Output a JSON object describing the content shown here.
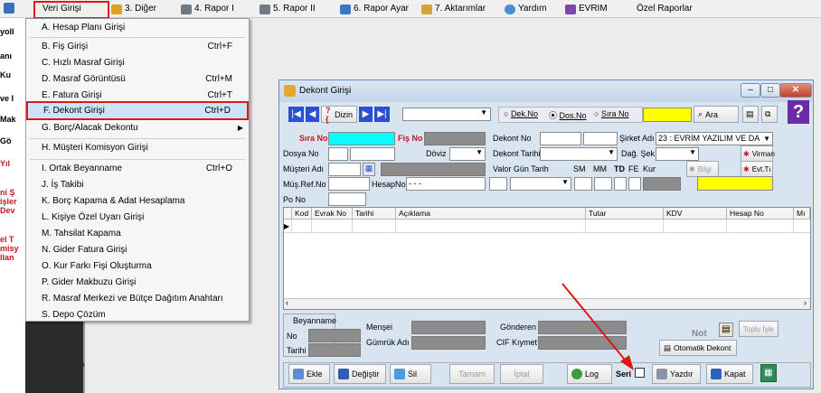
{
  "menubar": {
    "items": [
      {
        "label": "Veri Girişi"
      },
      {
        "label": "3. Diğer"
      },
      {
        "label": "4. Rapor I"
      },
      {
        "label": "5. Rapor II"
      },
      {
        "label": "6. Rapor Ayar"
      },
      {
        "label": "7. Aktarımlar"
      },
      {
        "label": "Yardım"
      },
      {
        "label": "EVRIM"
      },
      {
        "label": "Özel Raporlar"
      }
    ]
  },
  "left_strip": {
    "texts": [
      "yoll",
      "anı",
      "Ku",
      "ve I",
      "Mak",
      "Gö",
      "Yıl",
      "ni Ş",
      "işler",
      "Dev",
      "el T",
      "misy",
      "llan"
    ]
  },
  "dropdown": {
    "items": [
      {
        "label": "A. Hesap Planı Girişi",
        "shortcut": ""
      },
      {
        "label": "B. Fiş Girişi",
        "shortcut": "Ctrl+F"
      },
      {
        "label": "C. Hızlı Masraf Girişi",
        "shortcut": ""
      },
      {
        "label": "D. Masraf Görüntüsü",
        "shortcut": "Ctrl+M"
      },
      {
        "label": "E. Fatura Girişi",
        "shortcut": "Ctrl+T"
      },
      {
        "label": "F. Dekont Girişi",
        "shortcut": "Ctrl+D"
      },
      {
        "label": "G. Borç/Alacak Dekontu",
        "shortcut": ""
      },
      {
        "label": "H. Müşteri Komisyon Girişi",
        "shortcut": ""
      },
      {
        "label": "I. Ortak Beyanname",
        "shortcut": "Ctrl+O"
      },
      {
        "label": "J. İş Takibi",
        "shortcut": ""
      },
      {
        "label": "K. Borç Kapama & Adat Hesaplama",
        "shortcut": ""
      },
      {
        "label": "L. Kişiye Özel Uyarı Girişi",
        "shortcut": ""
      },
      {
        "label": "M. Tahsilat Kapama",
        "shortcut": ""
      },
      {
        "label": "N. Gider Fatura Girişi",
        "shortcut": ""
      },
      {
        "label": "O. Kur Farkı Fişi Oluşturma",
        "shortcut": ""
      },
      {
        "label": "P. Gider Makbuzu Girişi",
        "shortcut": ""
      },
      {
        "label": "R. Masraf Merkezi ve Bütçe Dağıtım Anahtarı",
        "shortcut": ""
      },
      {
        "label": "S. Depo Çözüm",
        "shortcut": ""
      }
    ]
  },
  "dialog": {
    "title": "Dekont Girişi",
    "toolbar": {
      "dizin": "Dizin",
      "radio_dek": "Dek.No",
      "radio_dos": "Dos.No",
      "radio_sira": "Sıra No",
      "ara": "Ara",
      "help": "?"
    },
    "form": {
      "sira_no": "Sıra No",
      "fis_no": "Fiş No",
      "dekont_no": "Dekont No",
      "sirket_adi": "Şirket Adı",
      "sirket_value": "23 : EVRİM YAZILIM  VE DA",
      "dosya_no": "Dosya No",
      "doviz": "Döviz",
      "dekont_tarihi": "Dekont Tarihi",
      "dag_sek": "Dağ. Şek.",
      "virman": "Virman",
      "musteri_adi": "Müşteri Adı",
      "valor": "Valor Gün Tarih",
      "sm": "SM",
      "mm": "MM",
      "td": "TD",
      "fe": "FE",
      "kur": "Kur",
      "bilgi": "Bilgi",
      "evt": "Evt.Tı",
      "mus_ref": "Müş.Ref.No",
      "hesap_no": "HesapNo",
      "hesap_value": " -  -  -",
      "po_no": "Po No"
    },
    "grid": {
      "headers": [
        "Kod",
        "Evrak No",
        "Tarihi",
        "Açıklama",
        "Tutar",
        "KDV",
        "Hesap No",
        "Mı"
      ]
    },
    "bottom": {
      "beyanname": "Beyanname",
      "no": "No",
      "tarihi": "Tarihi",
      "mensei": "Menşei",
      "gumruk": "Gümrük Adı",
      "gonderen": "Gönderen",
      "cif": "CIF Kıymet",
      "not": "Not",
      "toplu": "Toplu İşle",
      "otomatik": "Otomatik Dekont"
    },
    "buttons": {
      "ekle": "Ekle",
      "degistir": "Değiştir",
      "sil": "Sil",
      "tamam": "Tamam",
      "iptal": "İptal",
      "log": "Log",
      "seri": "Seri",
      "yazdir": "Yazdır",
      "kapat": "Kapat"
    }
  },
  "colors": {
    "highlight_red": "#e01515",
    "cyan": "#00ffff",
    "yellow": "#ffff00",
    "field_gray": "#8c8c8c"
  }
}
